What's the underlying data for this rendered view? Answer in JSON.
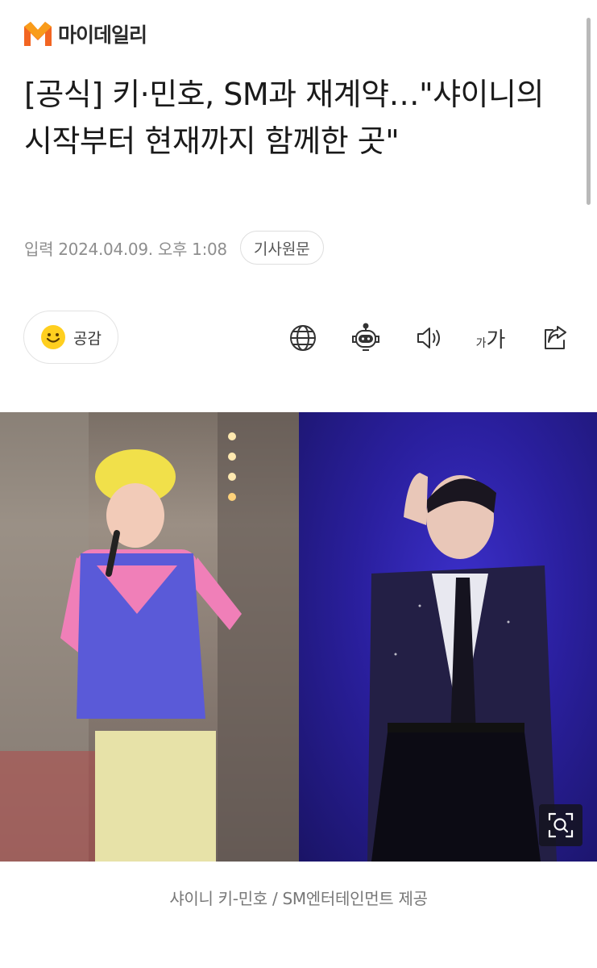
{
  "brand": {
    "logo_text": "마이데일리",
    "accent_color": "#f26522",
    "accent_color_2": "#f9a21b"
  },
  "article": {
    "headline": "[공식] 키·민호, SM과 재계약…\"샤이니의 시작부터 현재까지 함께한 곳\"",
    "published": "입력 2024.04.09. 오후 1:08",
    "source_button": "기사원문"
  },
  "actions": {
    "empathy_label": "공감",
    "tools": [
      {
        "name": "globe-icon",
        "label": "번역"
      },
      {
        "name": "robot-icon",
        "label": "요약봇"
      },
      {
        "name": "speaker-icon",
        "label": "본문 듣기"
      },
      {
        "name": "font-size-icon",
        "small": "가",
        "big": "가"
      },
      {
        "name": "share-icon",
        "label": "공유"
      }
    ]
  },
  "photo": {
    "caption": "샤이니 키-민호 / SM엔터테인먼트 제공"
  }
}
